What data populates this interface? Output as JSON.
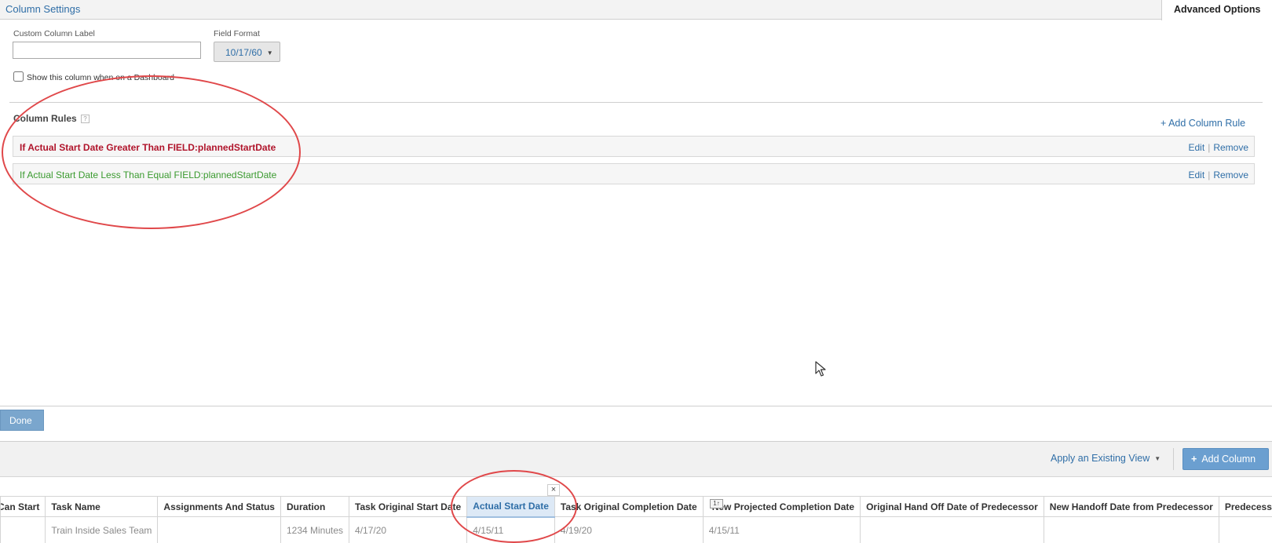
{
  "tabs": {
    "column_settings": "Column Settings",
    "advanced_options": "Advanced Options"
  },
  "settings": {
    "custom_label_title": "Custom Column Label",
    "custom_label_value": "",
    "field_format_title": "Field Format",
    "field_format_value": "10/17/60",
    "show_dashboard_label": "Show this column when on a Dashboard",
    "show_dashboard_checked": false
  },
  "rules": {
    "title": "Column Rules",
    "help": "?",
    "add_label": "+ Add Column Rule",
    "items": [
      {
        "text": "If Actual Start Date Greater Than FIELD:plannedStartDate",
        "edit": "Edit",
        "remove": "Remove",
        "color": "#b0142b"
      },
      {
        "text": "If Actual Start Date Less Than Equal FIELD:plannedStartDate",
        "edit": "Edit",
        "remove": "Remove",
        "color": "#3a9a2f"
      }
    ]
  },
  "done_label": "Done",
  "toolbar": {
    "apply_view": "Apply an Existing View",
    "add_column": "Add Column"
  },
  "grid": {
    "headers": [
      "Can Start",
      "Task Name",
      "Assignments And Status",
      "Duration",
      "Task Original Start Date",
      "Actual Start Date",
      "Task Original Completion Date",
      "New Projected Completion Date",
      "Original Hand Off Date of Predecessor",
      "New Handoff Date from Predecessor",
      "Predecessors"
    ],
    "row": [
      "",
      "Train Inside Sales Team",
      "",
      "1234 Minutes",
      "4/17/20",
      "4/15/11",
      "4/19/20",
      "4/15/11",
      "",
      "",
      ""
    ],
    "close_glyph": "×",
    "sort_badge": "1↑"
  }
}
